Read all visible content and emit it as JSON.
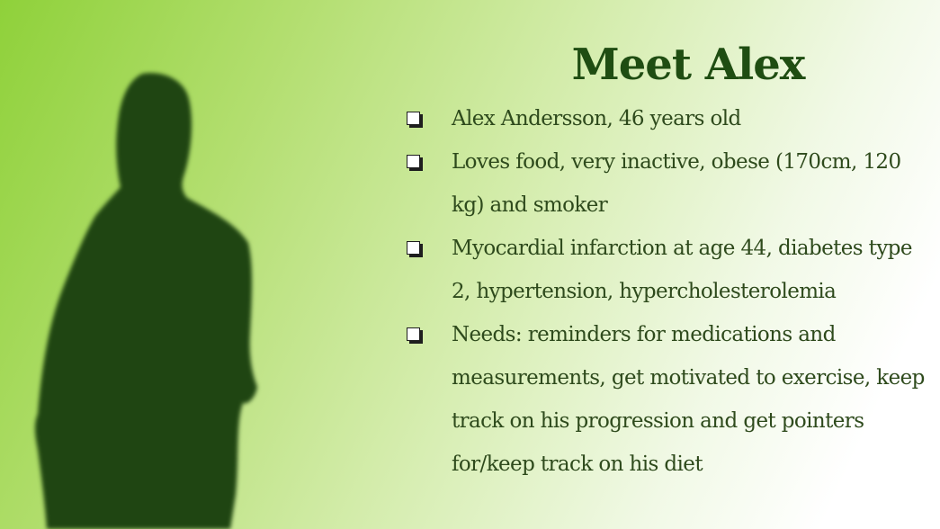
{
  "slide": {
    "title": "Meet Alex",
    "bullets": [
      {
        "text": "Alex Andersson, 46 years old"
      },
      {
        "text": "Loves food, very inactive, obese (170cm, 120 kg) and smoker"
      },
      {
        "text": "Myocardial infarction at age 44, diabetes type 2, hypertension, hypercholesterolemia"
      },
      {
        "text": "Needs: reminders for medications and measurements, get motivated to exercise, keep track on his progression and get pointers for/keep track on his diet"
      }
    ],
    "silhouette_icon": "person-silhouette-icon",
    "bullet_icon": "shadowed-square-bullet-icon",
    "colors": {
      "title": "#1f4d12",
      "text": "#2e4a1c",
      "silhouette": "#1f4512",
      "background_start": "#8fd13a",
      "background_end": "#ffffff"
    }
  }
}
